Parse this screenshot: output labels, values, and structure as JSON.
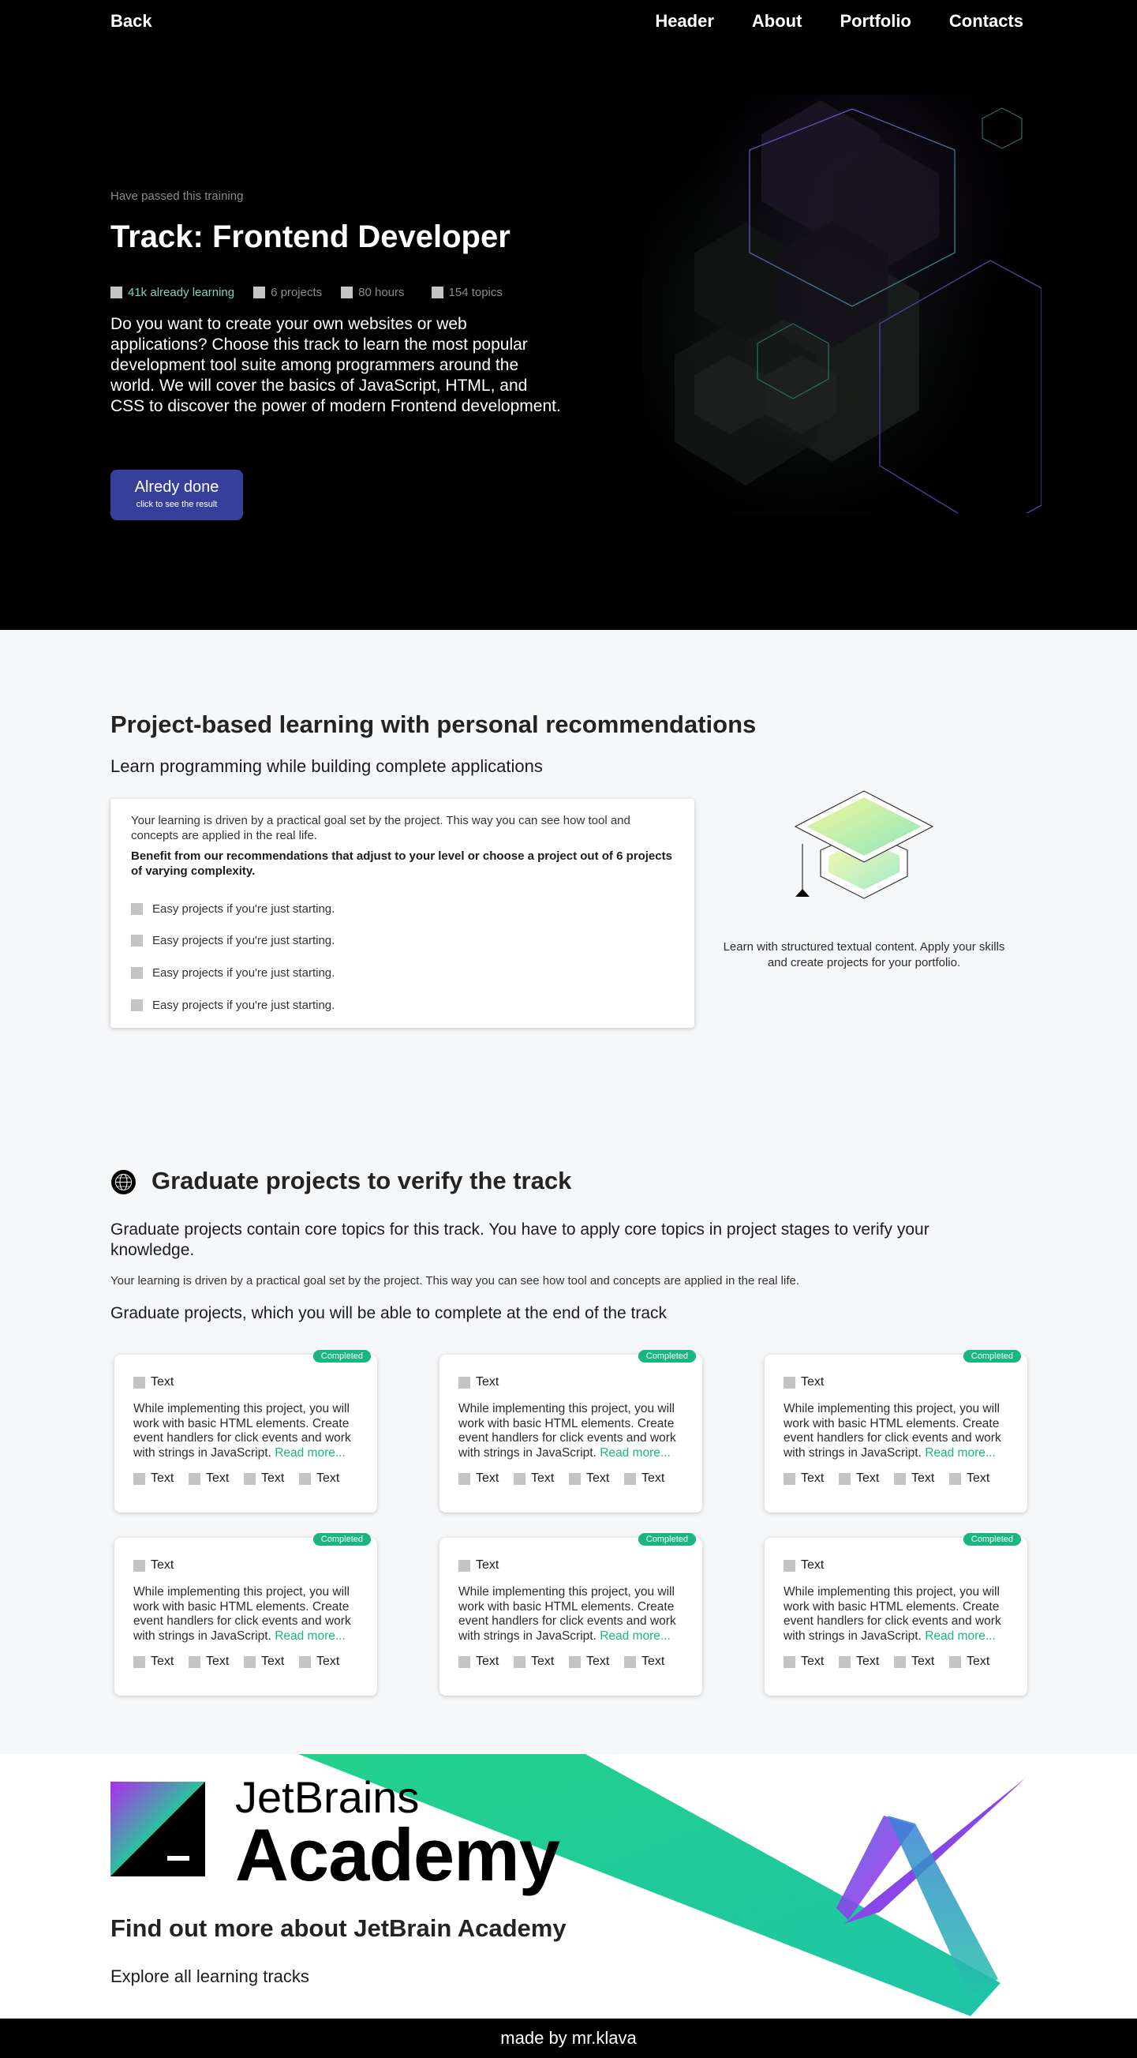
{
  "nav": {
    "back": "Back",
    "links": [
      "Header",
      "About",
      "Portfolio",
      "Contacts"
    ]
  },
  "hero": {
    "subtitle": "Have passed this training",
    "title": "Track: Frontend Developer",
    "stats": [
      "41k already learning",
      "6 projects",
      "80 hours",
      "154 topics"
    ],
    "description": "Do you want to create your own websites or web applications? Choose this track to learn the most popular development tool suite among programmers around the world. We will cover the basics of JavaScript, HTML, and CSS to discover the power of modern Frontend development.",
    "button_label": "Alredy done",
    "button_sub": "click to see the result"
  },
  "section2": {
    "title": "Project-based learning with personal recommendations",
    "subtitle": "Learn programming while building complete applications",
    "card_text": "Your learning is driven by a practical goal set by the project. This way you can see how tool and concepts are applied in the real life.",
    "card_bold": "Benefit from our recommendations that adjust to your level or choose a project out of 6 projects of varying complexity.",
    "list": [
      "Easy projects if you're just starting.",
      "Easy projects if you're just starting.",
      "Easy projects if you're just starting.",
      "Easy projects if you're just starting."
    ],
    "caption": "Learn with structured textual content. Apply your skills and create projects for your portfolio."
  },
  "section3": {
    "title": "Graduate projects to verify the track",
    "p1": "Graduate projects contain core topics for this track. You have to apply core topics in project stages to verify your knowledge.",
    "p2": "Your learning is driven by a practical goal set by the project. This way you can see how tool and concepts are applied in the real life.",
    "p3": "Graduate projects, which you will be able to complete at the end of the track",
    "cards": [
      {
        "badge": "Completed",
        "head": "Text",
        "desc": "While implementing this project, you will work with basic HTML elements. Create event handlers for click events and work with strings in JavaScript.",
        "more": "Read more...",
        "tags": [
          "Text",
          "Text",
          "Text",
          "Text"
        ]
      },
      {
        "badge": "Completed",
        "head": "Text",
        "desc": "While implementing this project, you will work with basic HTML elements. Create event handlers for click events and work with strings in JavaScript.",
        "more": "Read more...",
        "tags": [
          "Text",
          "Text",
          "Text",
          "Text"
        ]
      },
      {
        "badge": "Completed",
        "head": "Text",
        "desc": "While implementing this project, you will work with basic HTML elements. Create event handlers for click events and work with strings in JavaScript.",
        "more": "Read more...",
        "tags": [
          "Text",
          "Text",
          "Text",
          "Text"
        ]
      },
      {
        "badge": "Completed",
        "head": "Text",
        "desc": "While implementing this project, you will work with basic HTML elements. Create event handlers for click events and work with strings in JavaScript.",
        "more": "Read more...",
        "tags": [
          "Text",
          "Text",
          "Text",
          "Text"
        ]
      },
      {
        "badge": "Completed",
        "head": "Text",
        "desc": "While implementing this project, you will work with basic HTML elements. Create event handlers for click events and work with strings in JavaScript.",
        "more": "Read more...",
        "tags": [
          "Text",
          "Text",
          "Text",
          "Text"
        ]
      },
      {
        "badge": "Completed",
        "head": "Text",
        "desc": "While implementing this project, you will work with basic HTML elements. Create event handlers for click events and work with strings in JavaScript.",
        "more": "Read more...",
        "tags": [
          "Text",
          "Text",
          "Text",
          "Text"
        ]
      }
    ]
  },
  "academy": {
    "logo_word1": "JetBrains",
    "logo_word2": "Academy",
    "title": "Find out more about JetBrain Academy",
    "subtitle": "Explore all learning tracks"
  },
  "footer": {
    "text": "made by mr.klava"
  },
  "colors": {
    "accent_green": "#1ab581",
    "button_blue": "#36409a",
    "stat_accent": "#7dd3b8"
  }
}
